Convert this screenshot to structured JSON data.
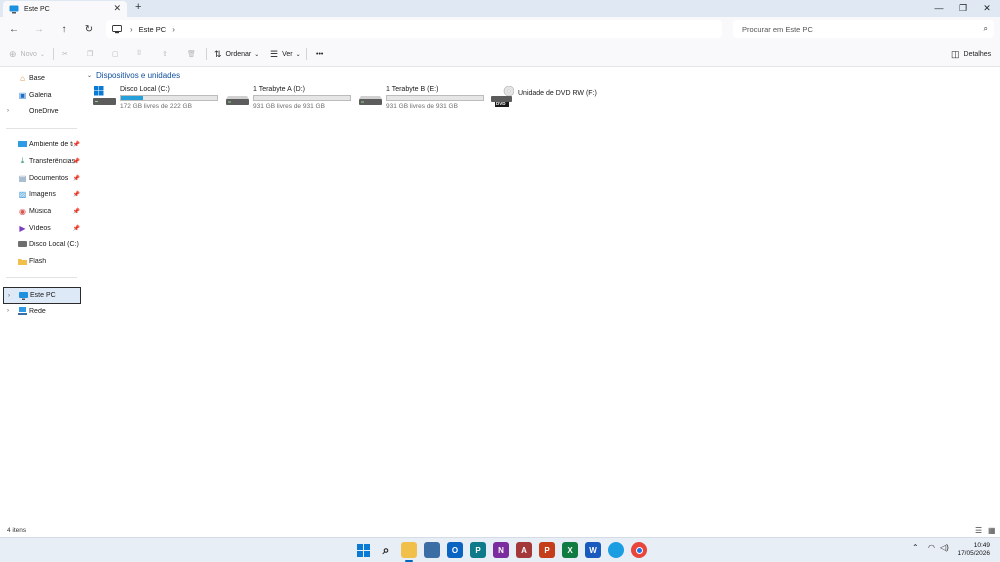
{
  "window": {
    "tab_title": "Este PC",
    "new_tab_symbol": "+",
    "close_symbol": "✕",
    "controls": {
      "minimize": "—",
      "maximize": "❐",
      "close": "✕"
    }
  },
  "address": {
    "breadcrumb": [
      "Este PC"
    ],
    "search_placeholder": "Procurar em Este PC"
  },
  "commands": {
    "new_label": "Novo",
    "sort_label": "Ordenar",
    "view_label": "Ver",
    "more_label": "•••",
    "details_label": "Detalhes"
  },
  "sidebar": {
    "items": [
      {
        "label": "Base",
        "icon": "home-icon"
      },
      {
        "label": "Galeria",
        "icon": "gallery-icon"
      },
      {
        "label": "OneDrive",
        "icon": "cloud-icon"
      },
      {
        "label": "Ambiente de trabalho",
        "icon": "desktop-icon"
      },
      {
        "label": "Transferências",
        "icon": "download-icon"
      },
      {
        "label": "Documentos",
        "icon": "document-icon"
      },
      {
        "label": "Imagens",
        "icon": "pictures-icon"
      },
      {
        "label": "Música",
        "icon": "music-icon"
      },
      {
        "label": "Vídeos",
        "icon": "video-icon"
      },
      {
        "label": "Disco Local (C:)",
        "icon": "drive-icon"
      },
      {
        "label": "Flash",
        "icon": "folder-icon"
      },
      {
        "label": "Este PC",
        "icon": "computer-icon"
      },
      {
        "label": "Rede",
        "icon": "network-icon"
      }
    ]
  },
  "main": {
    "group_title": "Dispositivos e unidades",
    "drives": [
      {
        "name": "Disco Local (C:)",
        "free": "172 GB livres de 222 GB",
        "used_fraction": 0.225,
        "icon": "windows-drive-icon"
      },
      {
        "name": "1 Terabyte A (D:)",
        "free": "931 GB livres de 931 GB",
        "used_fraction": 0.0,
        "icon": "hard-drive-icon"
      },
      {
        "name": "1 Terabyte B (E:)",
        "free": "931 GB livres de 931 GB",
        "used_fraction": 0.0,
        "icon": "hard-drive-icon"
      },
      {
        "name": "Unidade de DVD RW (F:)",
        "badge": "DVD",
        "icon": "dvd-drive-icon"
      }
    ]
  },
  "status": {
    "item_count": "4 itens"
  },
  "taskbar": {
    "time": "10:49",
    "date": "17/05/2026"
  },
  "colors": {
    "accent": "#0067c0",
    "bar_fill": "#26a0da",
    "group_header": "#0f4f9e"
  }
}
